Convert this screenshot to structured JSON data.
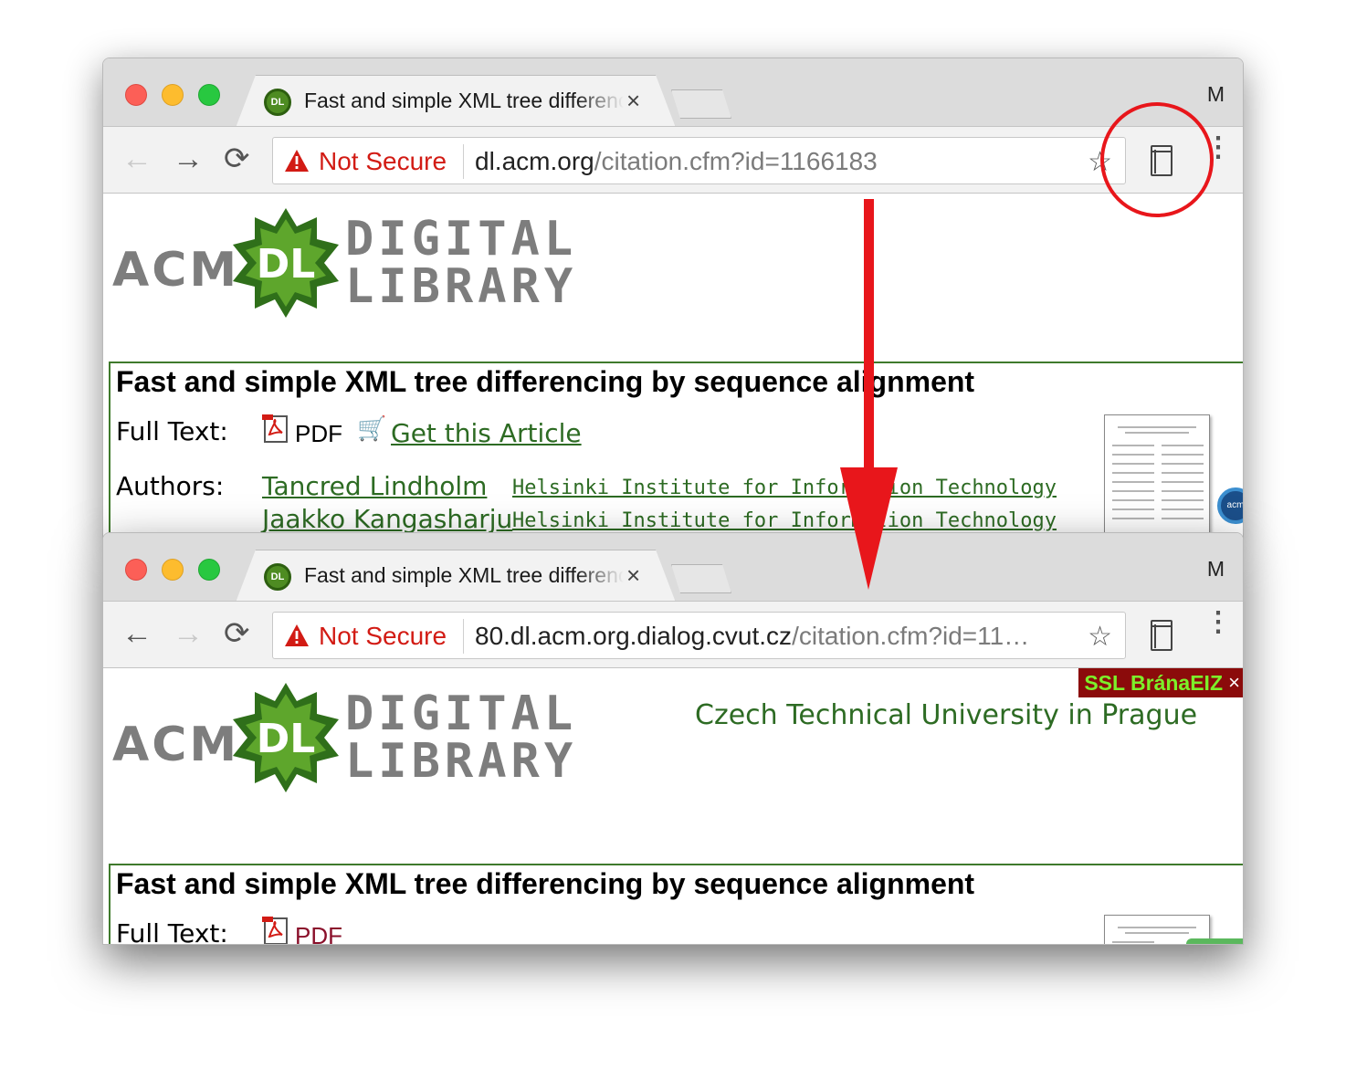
{
  "windows": [
    {
      "tab_title": "Fast and simple XML tree differencing by sequence alignment",
      "tab_favicon": "DL",
      "tab_close": "×",
      "profile": "M",
      "nav": {
        "back": "←",
        "forward": "→",
        "reload": "⟳"
      },
      "security_label": "Not Secure",
      "url_host": "dl.acm.org",
      "url_path": "/citation.cfm?id=1166183",
      "star": "☆",
      "menu": "⋮",
      "logo": {
        "acm": "ACM",
        "dl": "DL",
        "digital": "DIGITAL",
        "library": "LIBRARY"
      },
      "citation": {
        "title": "Fast and simple XML tree differencing by sequence alignment",
        "full_text_label": "Full Text:",
        "pdf_label": "PDF",
        "get_article_label": "Get this Article",
        "authors_label": "Authors:",
        "authors": [
          {
            "name": "Tancred Lindholm",
            "affiliation": "Helsinki Institute for Information Technology"
          },
          {
            "name": "Jaakko Kangasharju",
            "affiliation": "Helsinki Institute for Information Technology"
          }
        ]
      },
      "acm_badge": "acm"
    },
    {
      "tab_title": "Fast and simple XML tree differencing by sequence alignment",
      "tab_favicon": "DL",
      "tab_close": "×",
      "profile": "M",
      "nav": {
        "back": "←",
        "forward": "→",
        "reload": "⟳"
      },
      "security_label": "Not Secure",
      "url_host": "80.dl.acm.org.dialog.cvut.cz",
      "url_path": "/citation.cfm?id=11…",
      "star": "☆",
      "menu": "⋮",
      "logo": {
        "acm": "ACM",
        "dl": "DL",
        "digital": "DIGITAL",
        "library": "LIBRARY"
      },
      "ssl_badge": "SSL BránaEIZ",
      "ssl_close": "×",
      "institution": "Czech Technical University in Prague",
      "citation": {
        "title": "Fast and simple XML tree differencing by sequence alignment",
        "full_text_label": "Full Text:",
        "pdf_label": "PDF"
      }
    }
  ],
  "colors": {
    "not_secure": "#d21b14",
    "link_green": "#2d6b23",
    "annotation_red": "#e8161b",
    "ssl_bg": "#8b0b0b",
    "ssl_text": "#7cf02a"
  }
}
